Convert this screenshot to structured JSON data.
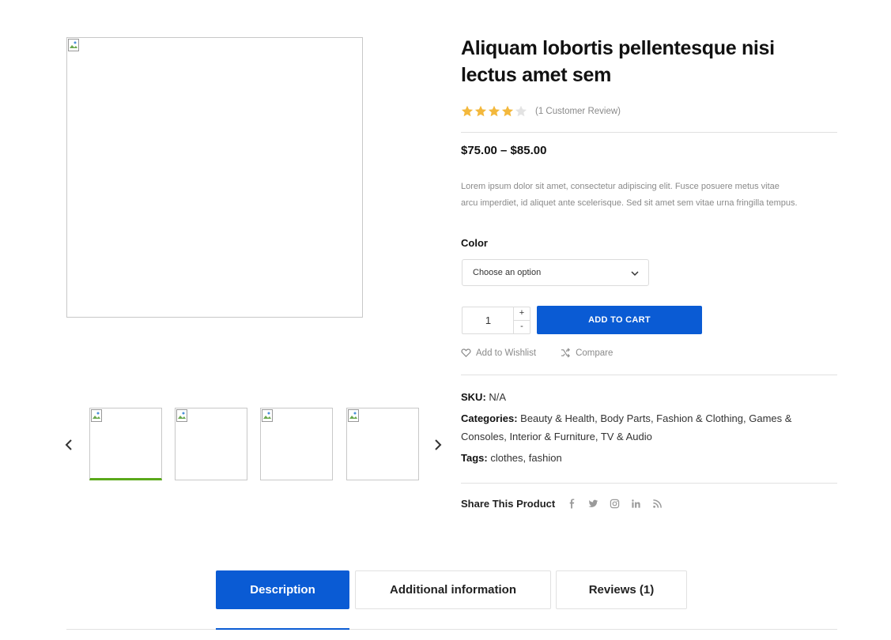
{
  "product": {
    "title_line1": "Aliquam lobortis pellentesque nisi",
    "title_line2": "lectus amet sem",
    "rating_value": 4,
    "rating_max": 5,
    "review_link": "(1 Customer Review)",
    "price": "$75.00 – $85.00",
    "description_line1": "Lorem ipsum dolor sit amet, consectetur adipiscing elit. Fusce posuere metus vitae",
    "description_line2": "arcu imperdiet, id aliquet ante scelerisque. Sed sit amet sem vitae urna fringilla tempus."
  },
  "variation": {
    "label": "Color",
    "select_value": "Choose an option"
  },
  "cart": {
    "quantity": "1",
    "plus": "+",
    "minus": "-",
    "add_label": "ADD TO CART"
  },
  "actions": {
    "wishlist": "Add to Wishlist",
    "compare": "Compare"
  },
  "meta": {
    "sku_label": "SKU:",
    "sku_value": "N/A",
    "categories_label": "Categories:",
    "categories": [
      "Beauty & Health",
      "Body Parts",
      "Fashion & Clothing",
      "Games &",
      "Consoles",
      "Interior & Furniture",
      "TV & Audio"
    ],
    "tags_label": "Tags:",
    "tags": [
      "clothes",
      "fashion"
    ]
  },
  "share": {
    "label": "Share This Product",
    "icons": [
      "facebook-icon",
      "twitter-icon",
      "instagram-icon",
      "linkedin-icon",
      "rss-icon"
    ]
  },
  "tabs": [
    {
      "label": "Description",
      "active": true
    },
    {
      "label": "Additional information",
      "active": false
    },
    {
      "label": "Reviews (1)",
      "active": false
    }
  ],
  "colors": {
    "accent": "#0a5bd4",
    "star": "#f3b83c",
    "thumb_active": "#5aa81a"
  }
}
